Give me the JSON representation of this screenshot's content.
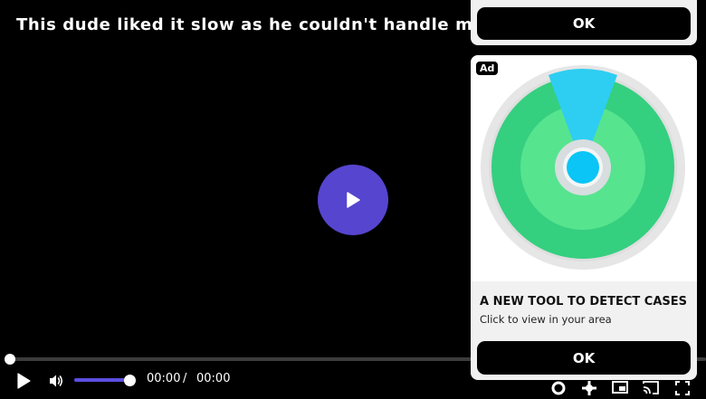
{
  "video": {
    "title": "This dude liked it slow as he couldn't handle my big",
    "accent_color": "#5645cf",
    "progress_fraction": 0,
    "volume_fraction": 1
  },
  "controls": {
    "current_time": "00:00",
    "separator": "/",
    "duration": "00:00",
    "icons": [
      "play-icon",
      "volume-icon",
      "settings-icon",
      "fullscreen-icon"
    ]
  },
  "ads": {
    "top_card": {
      "ok_label": "OK"
    },
    "main_card": {
      "badge": "Ad",
      "headline": "A NEW TOOL TO DETECT CASES",
      "subtext": "Click to view in your area",
      "ok_label": "OK"
    }
  }
}
